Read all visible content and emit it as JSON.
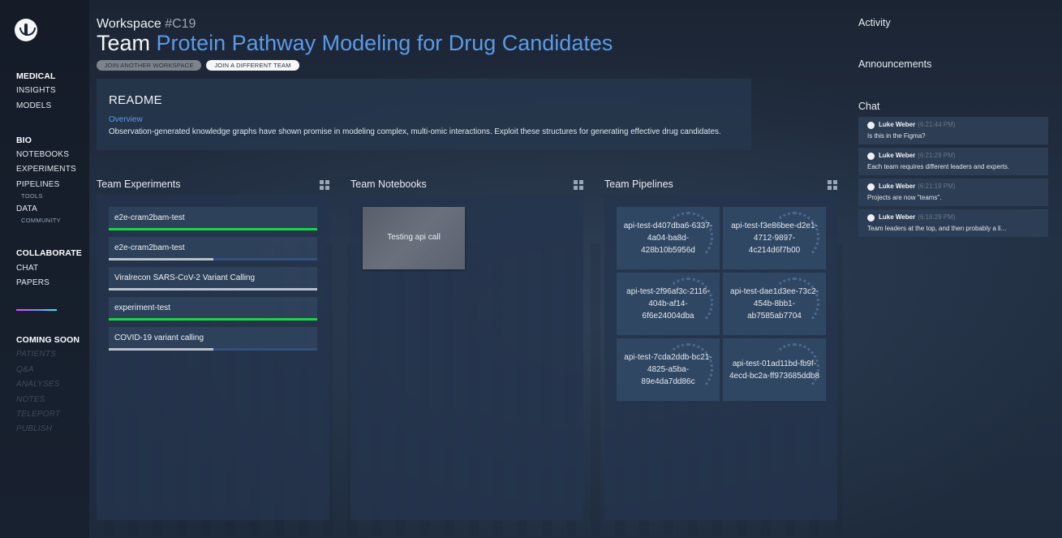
{
  "colors": {
    "accent_blue": "#5b9ae8",
    "progress_green": "#19d642",
    "progress_grey": "#b9c2cc",
    "progress_track": "#33507a"
  },
  "nav": {
    "sections": [
      {
        "heading": "MEDICAL",
        "items": [
          "INSIGHTS",
          "MODELS"
        ]
      },
      {
        "heading": "BIO",
        "items": [
          "NOTEBOOKS",
          "EXPERIMENTS",
          "PIPELINES",
          "TOOLS",
          "DATA",
          "COMMUNITY"
        ]
      },
      {
        "heading": "COLLABORATE",
        "items": [
          "CHAT",
          "PAPERS"
        ]
      },
      {
        "heading": "COMING SOON",
        "items": [
          "PATIENTS",
          "Q&A",
          "ANALYSES",
          "NOTES",
          "TELEPORT",
          "PUBLISH"
        ]
      }
    ]
  },
  "header": {
    "workspace_label": "Workspace",
    "workspace_code": "#C19",
    "team_label": "Team",
    "team_name": "Protein Pathway Modeling for Drug Candidates",
    "join_workspace": "JOIN ANOTHER WORKSPACE",
    "join_team": "JOIN A DIFFERENT TEAM"
  },
  "readme": {
    "heading": "README",
    "section": "Overview",
    "text": "Observation-generated knowledge graphs have shown promise in modeling complex, multi-omic interactions. Exploit these structures for generating effective drug candidates."
  },
  "experiments": {
    "title": "Team Experiments",
    "icon": "grid-icon",
    "items": [
      {
        "name": "e2e-cram2bam-test",
        "progress": 1.0,
        "color": "#19d642"
      },
      {
        "name": "e2e-cram2bam-test",
        "progress": 0.5,
        "color": "#b9c2cc"
      },
      {
        "name": "Viralrecon SARS-CoV-2 Variant Calling",
        "progress": 1.0,
        "color": "#b9c2cc"
      },
      {
        "name": "experiment-test",
        "progress": 1.0,
        "color": "#19d642"
      },
      {
        "name": "COVID-19 variant calling",
        "progress": 0.5,
        "color": "#b9c2cc"
      }
    ]
  },
  "notebooks": {
    "title": "Team Notebooks",
    "icon": "grid-icon",
    "items": [
      {
        "name": "Testing api call"
      }
    ]
  },
  "pipelines": {
    "title": "Team Pipelines",
    "icon": "grid-icon",
    "items": [
      {
        "name": "api-test-d407dba6-6337-4a04-ba8d-428b10b5956d",
        "lines": [
          "api-test-d407dba6-6337-",
          "4a04-ba8d-",
          "428b10b5956d"
        ]
      },
      {
        "name": "api-test-f3e86bee-d2e1-4712-9897-4c214d6f7b00",
        "lines": [
          "api-test-f3e86bee-d2e1-",
          "4712-9897-",
          "4c214d6f7b00"
        ]
      },
      {
        "name": "api-test-2f96af3c-2116-404b-af14-6f6e24004dba",
        "lines": [
          "api-test-2f96af3c-2116-",
          "404b-af14-",
          "6f6e24004dba"
        ]
      },
      {
        "name": "api-test-dae1d3ee-73c2-454b-8bb1-ab7585ab7704",
        "lines": [
          "api-test-dae1d3ee-73c2-",
          "454b-8bb1-",
          "ab7585ab7704"
        ]
      },
      {
        "name": "api-test-7cda2ddb-bc21-4825-a5ba-89e4da7dd86c",
        "lines": [
          "api-test-7cda2ddb-bc21-",
          "4825-a5ba-",
          "89e4da7dd86c"
        ]
      },
      {
        "name": "api-test-01ad11bd-fb9f-4ecd-bc2a-ff973685ddb8",
        "lines": [
          "api-test-01ad11bd-fb9f-",
          "4ecd-bc2a-ff973685ddb8"
        ]
      }
    ]
  },
  "right": {
    "activity": "Activity",
    "announcements": "Announcements",
    "chat": "Chat",
    "messages": [
      {
        "user": "Luke Weber",
        "time": "(6:21:44 PM)",
        "text": "Is this in the Figma?"
      },
      {
        "user": "Luke Weber",
        "time": "(6:21:29 PM)",
        "text": "Each team requires different leaders and experts."
      },
      {
        "user": "Luke Weber",
        "time": "(6:21:19 PM)",
        "text": "Projects are now \"teams\"."
      },
      {
        "user": "Luke Weber",
        "time": "(6:16:29 PM)",
        "text": "Team leaders at the top, and then probably a li..."
      }
    ]
  }
}
